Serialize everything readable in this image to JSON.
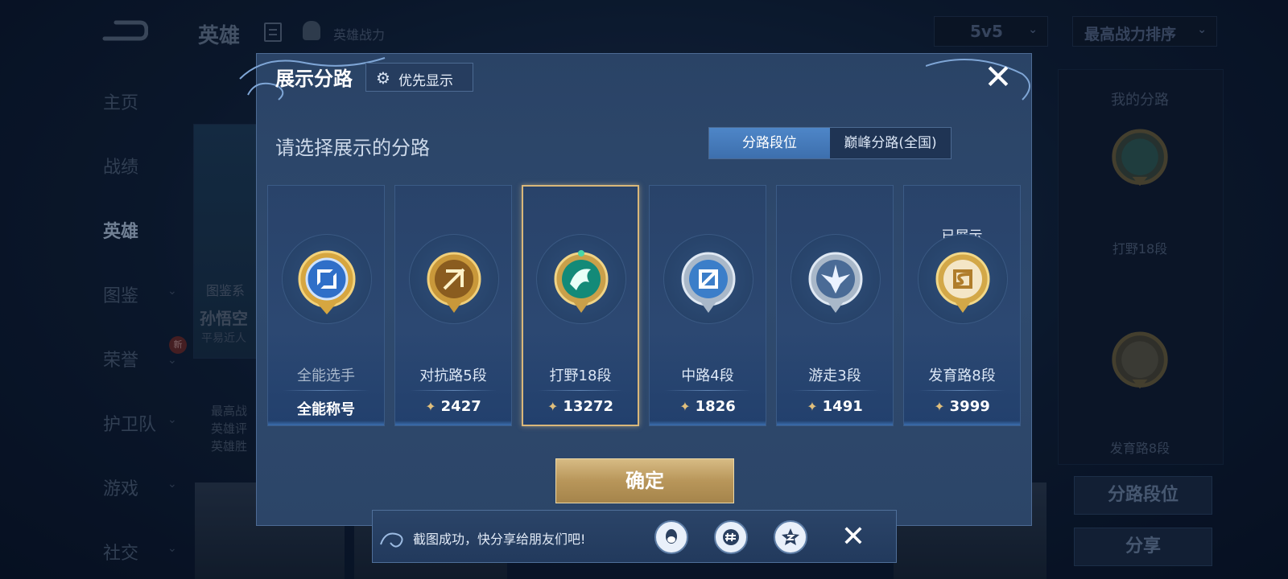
{
  "background": {
    "title": "英雄",
    "power_label": "英雄战力",
    "mode": "5v5",
    "sort": "最高战力排序",
    "nav": [
      {
        "label": "主页",
        "chev": false
      },
      {
        "label": "战绩",
        "chev": false
      },
      {
        "label": "英雄",
        "chev": false,
        "active": true
      },
      {
        "label": "图鉴",
        "chev": true
      },
      {
        "label": "荣誉",
        "chev": true,
        "badge": "新"
      },
      {
        "label": "护卫队",
        "chev": true
      },
      {
        "label": "游戏",
        "chev": true
      },
      {
        "label": "社交",
        "chev": true
      }
    ],
    "hero_tag": "图鉴系",
    "hero_name": "孙悟空",
    "hero_sub": "平易近人",
    "hero_lines": [
      "最高战",
      "英雄评",
      "英雄胜"
    ],
    "right_panel": {
      "title": "我的分路",
      "label_1": "打野18段",
      "label_2": "发育路8段",
      "btn_lane": "分路段位",
      "btn_share": "分享"
    }
  },
  "modal": {
    "title": "展示分路",
    "priority_label": "优先显示",
    "prompt": "请选择展示的分路",
    "tab_active": "分路段位",
    "tab_other": "巅峰分路(全国)",
    "cards": [
      {
        "name": "全能选手",
        "value": "全能称号",
        "medal": "allround-medal-icon",
        "shown": ""
      },
      {
        "name": "对抗路5段",
        "value": "2427",
        "medal": "clash-lane-medal-icon",
        "shown": ""
      },
      {
        "name": "打野18段",
        "value": "13272",
        "medal": "jungle-medal-icon",
        "shown": "",
        "selected": true
      },
      {
        "name": "中路4段",
        "value": "1826",
        "medal": "mid-lane-medal-icon",
        "shown": ""
      },
      {
        "name": "游走3段",
        "value": "1491",
        "medal": "roam-medal-icon",
        "shown": ""
      },
      {
        "name": "发育路8段",
        "value": "3999",
        "medal": "farm-lane-medal-icon",
        "shown": "已展示"
      }
    ],
    "confirm_label": "确定"
  },
  "toast": {
    "message": "截图成功，快分享给朋友们吧!",
    "share_icons": [
      "qq-icon",
      "wechat-moments-icon",
      "qzone-icon"
    ]
  },
  "colors": {
    "gold": "#d7bb84",
    "accent_blue": "#4e86c8",
    "modal_bg": "#2c4568"
  }
}
